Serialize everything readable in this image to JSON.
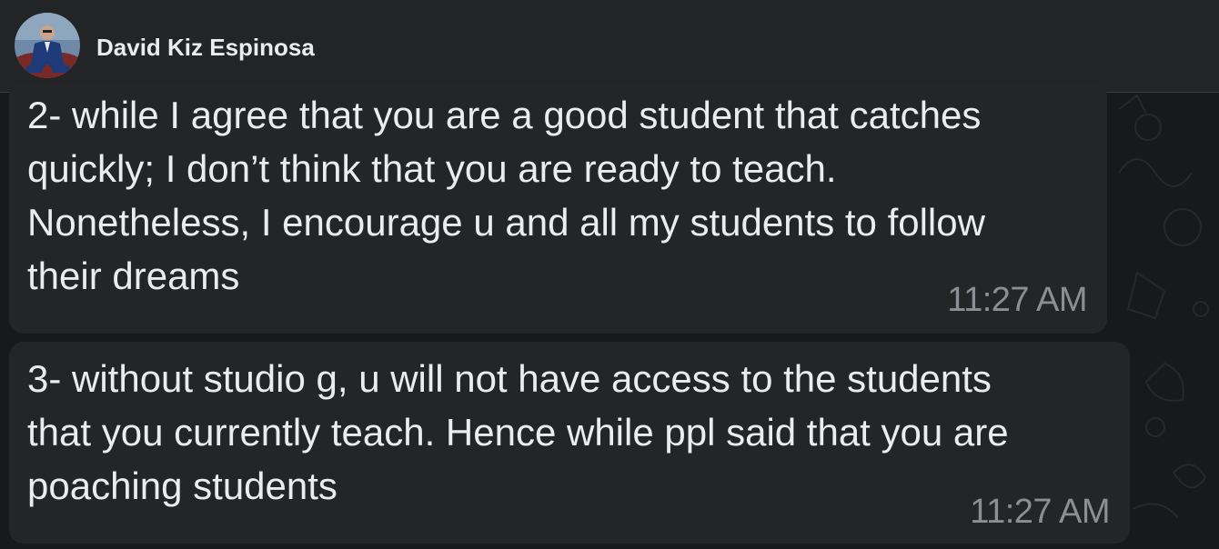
{
  "header": {
    "contact_name": "David Kiz Espinosa"
  },
  "messages": [
    {
      "lines": [
        "2- while I agree that you are a good student that catches",
        "quickly; I don’t think that you are ready to teach.",
        "Nonetheless, I encourage u and all my students to follow",
        "their dreams"
      ],
      "time": "11:27 AM"
    },
    {
      "lines": [
        "3- without studio g, u will not have access to the students",
        "that you currently teach. Hence while ppl said that you are",
        "poaching students"
      ],
      "time": "11:27 AM"
    }
  ],
  "colors": {
    "header_bg": "#222425",
    "bubble_bg": "#232527",
    "text": "#e9edef",
    "timestamp": "#8b8f93"
  }
}
